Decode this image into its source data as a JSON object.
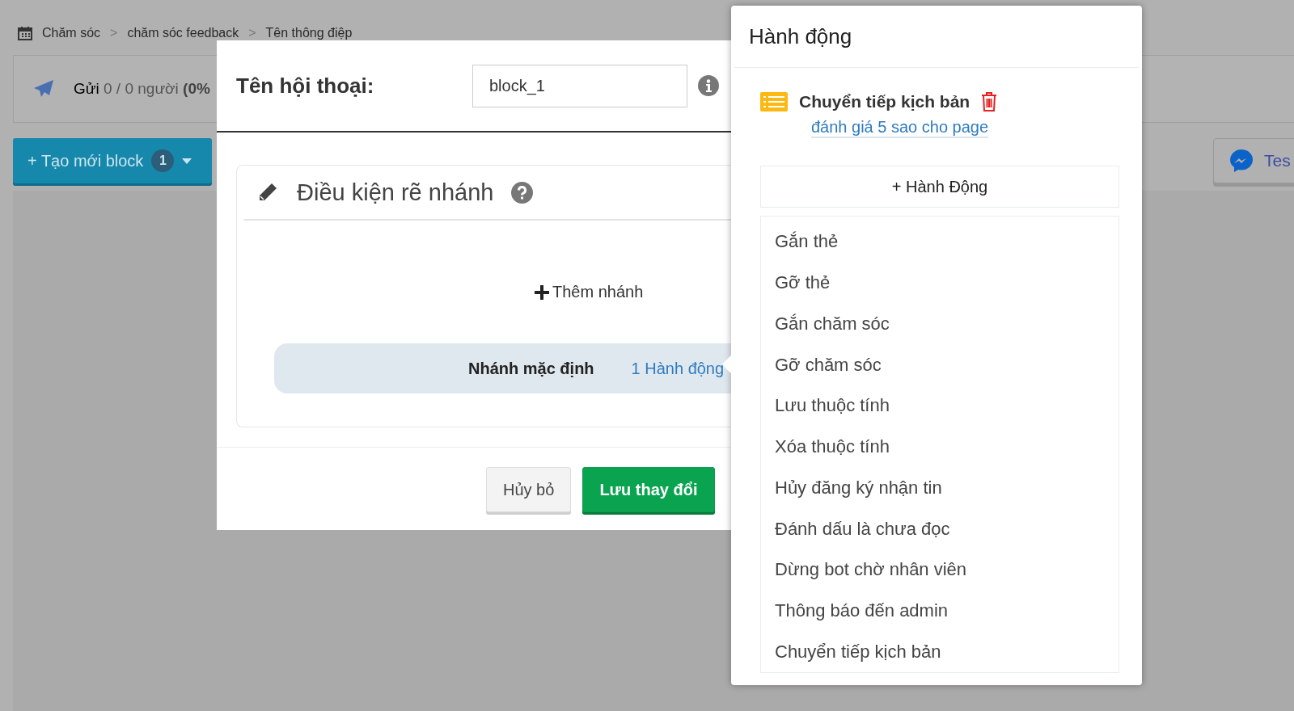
{
  "breadcrumb": {
    "items": [
      "Chăm sóc",
      "chăm sóc feedback",
      "Tên thông điệp"
    ],
    "separators": [
      ">",
      ">"
    ]
  },
  "send_stats": {
    "label": "Gửi",
    "value": "0 / 0 người",
    "percent": "(0%"
  },
  "create_button": {
    "label": "+ Tạo mới block",
    "count": "1"
  },
  "test_button": {
    "label": "Tes"
  },
  "dialog": {
    "name_label": "Tên hội thoại:",
    "name_value": "block_1",
    "section_title": "Điều kiện rẽ nhánh",
    "add_branch": "Thêm nhánh",
    "default_branch": {
      "label": "Nhánh mặc định",
      "actions": "1 Hành động"
    },
    "buttons": [
      {
        "label": "Hủy bỏ",
        "kind": "secondary"
      },
      {
        "label": "Lưu thay đổi",
        "kind": "primary"
      }
    ]
  },
  "actions_panel": {
    "title": "Hành động",
    "actions": [
      {
        "name": "Chuyển tiếp kịch bản",
        "target": "đánh giá 5 sao cho page"
      }
    ],
    "add_button": "+ Hành Động",
    "menu": [
      "Gắn thẻ",
      "Gỡ thẻ",
      "Gắn chăm sóc",
      "Gỡ chăm sóc",
      "Lưu thuộc tính",
      "Xóa thuộc tính",
      "Hủy đăng ký nhận tin",
      "Đánh dấu là chưa đọc",
      "Dừng bot chờ nhân viên",
      "Thông báo đến admin",
      "Chuyển tiếp kịch bản"
    ]
  }
}
